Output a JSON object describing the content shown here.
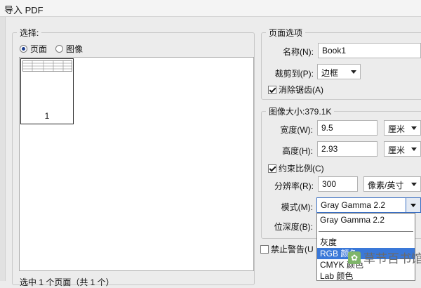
{
  "window": {
    "title": "导入 PDF"
  },
  "select_group": {
    "legend": "选择:",
    "options": [
      {
        "label": "页面",
        "selected": true
      },
      {
        "label": "图像",
        "selected": false
      }
    ],
    "thumbnail_page_number": "1",
    "status": "选中 1 个页面（共 1 个）"
  },
  "page_options": {
    "legend": "页面选项",
    "name_label": "名称(N):",
    "name_value": "Book1",
    "crop_label": "裁剪到(P):",
    "crop_value": "边框",
    "antialias_label": "消除锯齿(A)",
    "antialias_checked": true
  },
  "image_size": {
    "legend": "图像大小:379.1K",
    "width_label": "宽度(W):",
    "width_value": "9.5",
    "width_unit": "厘米",
    "height_label": "高度(H):",
    "height_value": "2.93",
    "height_unit": "厘米",
    "constrain_label": "约束比例(C)",
    "constrain_checked": true,
    "resolution_label": "分辨率(R):",
    "resolution_value": "300",
    "resolution_unit": "像素/英寸",
    "mode_label": "模式(M):",
    "mode_value": "Gray Gamma 2.2",
    "depth_label": "位深度(B):",
    "mode_options": [
      "Gray Gamma 2.2",
      "灰度",
      "RGB 颜色",
      "CMYK 颜色",
      "Lab 颜色"
    ],
    "mode_highlighted_index": 2
  },
  "suppress_warnings": {
    "label": "禁止警告(U",
    "checked": false
  },
  "watermark": {
    "text": "草节百书馆",
    "icon": "leaf-icon"
  }
}
